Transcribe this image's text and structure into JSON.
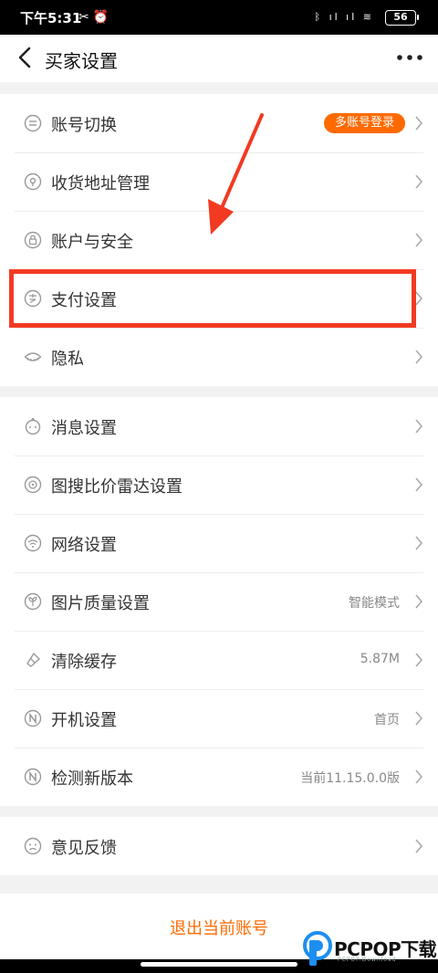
{
  "status_bar": {
    "time": "下午5:31",
    "battery": "56"
  },
  "header": {
    "title": "买家设置"
  },
  "groups": {
    "account": [
      {
        "label": "账号切换",
        "badge": "多账号登录",
        "icon": "switch-icon"
      },
      {
        "label": "收货地址管理",
        "icon": "location-icon"
      },
      {
        "label": "账户与安全",
        "icon": "lock-icon"
      },
      {
        "label": "支付设置",
        "icon": "payment-icon"
      },
      {
        "label": "隐私",
        "icon": "eye-closed-icon"
      }
    ],
    "general": [
      {
        "label": "消息设置",
        "icon": "message-icon"
      },
      {
        "label": "图搜比价雷达设置",
        "icon": "radar-icon"
      },
      {
        "label": "网络设置",
        "icon": "wifi-icon"
      },
      {
        "label": "图片质量设置",
        "value": "智能模式",
        "icon": "image-quality-icon"
      },
      {
        "label": "清除缓存",
        "value": "5.87M",
        "icon": "clear-cache-icon"
      },
      {
        "label": "开机设置",
        "value": "首页",
        "icon": "startup-icon"
      },
      {
        "label": "检测新版本",
        "value": "当前11.15.0.0版",
        "icon": "version-icon"
      }
    ],
    "feedback": [
      {
        "label": "意见反馈",
        "icon": "feedback-icon"
      }
    ]
  },
  "logout": {
    "label": "退出当前账号"
  },
  "watermark": {
    "brand": "PCPOP下载",
    "sub": "PCPOP.Download"
  },
  "colors": {
    "accent": "#ff6a00",
    "highlight": "#f23a22"
  }
}
